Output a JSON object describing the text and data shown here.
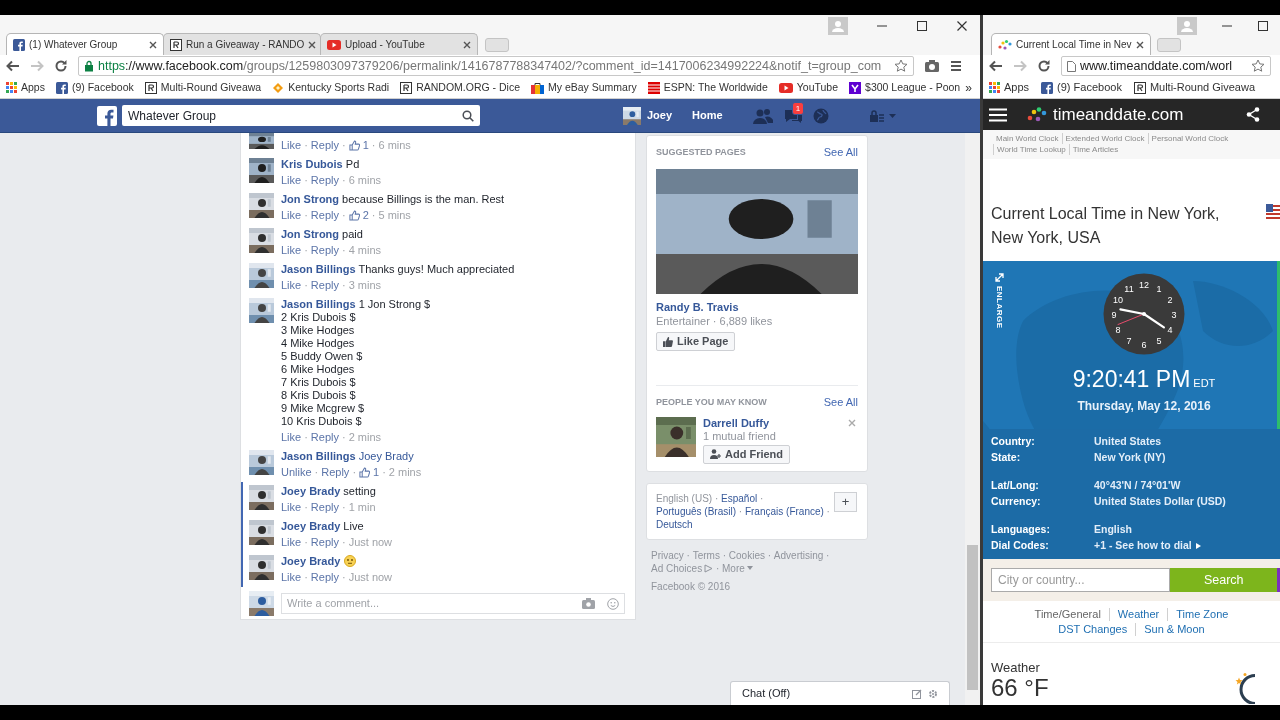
{
  "separator": "·",
  "left_window": {
    "tabs": [
      {
        "label": "(1) Whatever Group",
        "kind": "facebook",
        "selected": true
      },
      {
        "label": "Run a Giveaway - RANDO",
        "kind": "random",
        "selected": false
      },
      {
        "label": "Upload - YouTube",
        "kind": "youtube",
        "selected": false
      }
    ],
    "url": {
      "scheme": "https",
      "host": "://www.facebook.com",
      "path": "/groups/1259803097379206/permalink/1416787788347402/?comment_id=1417006234992224&notif_t=group_com"
    },
    "bookmarks": [
      {
        "label": "Apps",
        "kind": "apps"
      },
      {
        "label": "(9) Facebook",
        "kind": "facebook"
      },
      {
        "label": "Multi-Round Giveawa",
        "kind": "random"
      },
      {
        "label": "Kentucky Sports Radi",
        "kind": "kentucky"
      },
      {
        "label": "RANDOM.ORG - Dice",
        "kind": "random"
      },
      {
        "label": "My eBay Summary",
        "kind": "ebay"
      },
      {
        "label": "ESPN: The Worldwide",
        "kind": "espn"
      },
      {
        "label": "YouTube",
        "kind": "youtube"
      },
      {
        "label": "$300 League - Poon",
        "kind": "yahoo"
      }
    ],
    "more_bookmarks": "»"
  },
  "facebook": {
    "search_value": "Whatever Group",
    "user": "Joey",
    "home": "Home",
    "notification_count": "1",
    "comments": [
      {
        "kind": "partial",
        "like": "Like",
        "reply": "Reply",
        "likes": "1",
        "time": "6 mins",
        "highlighted": false
      },
      {
        "kind": "text",
        "author": "Kris Dubois",
        "lines": [
          "Pd"
        ],
        "like": "Like",
        "reply": "Reply",
        "time": "6 mins",
        "highlighted": false
      },
      {
        "kind": "text",
        "author": "Jon Strong",
        "lines": [
          "because Billings is the man. Rest"
        ],
        "like": "Like",
        "reply": "Reply",
        "likes": "2",
        "time": "5 mins",
        "highlighted": false
      },
      {
        "kind": "text",
        "author": "Jon Strong",
        "lines": [
          "paid"
        ],
        "like": "Like",
        "reply": "Reply",
        "time": "4 mins",
        "highlighted": false
      },
      {
        "kind": "text",
        "author": "Jason Billings",
        "lines": [
          "Thanks guys! Much appreciated"
        ],
        "like": "Like",
        "reply": "Reply",
        "time": "3 mins",
        "highlighted": false
      },
      {
        "kind": "text",
        "author": "Jason Billings",
        "lines": [
          "1 Jon Strong $",
          "2 Kris Dubois $",
          "3 Mike Hodges",
          "4 Mike Hodges",
          "5 Buddy Owen $",
          "6 Mike Hodges",
          "7 Kris Dubois $",
          "8 Kris Dubois $",
          "9 Mike Mcgrew $",
          "10 Kris Dubois $"
        ],
        "like": "Like",
        "reply": "Reply",
        "time": "2 mins",
        "highlighted": false
      },
      {
        "kind": "tag",
        "author": "Jason Billings",
        "tag": "Joey Brady",
        "like": "Unlike",
        "reply": "Reply",
        "likes": "1",
        "time": "2 mins",
        "highlighted": false
      },
      {
        "kind": "text",
        "author": "Joey Brady",
        "lines": [
          "setting"
        ],
        "like": "Like",
        "reply": "Reply",
        "time": "1 min",
        "highlighted": true
      },
      {
        "kind": "text",
        "author": "Joey Brady",
        "lines": [
          "Live"
        ],
        "like": "Like",
        "reply": "Reply",
        "time": "Just now",
        "highlighted": true
      },
      {
        "kind": "emoji",
        "author": "Joey Brady",
        "like": "Like",
        "reply": "Reply",
        "time": "Just now",
        "highlighted": true
      }
    ],
    "comment_placeholder": "Write a comment...",
    "suggested_pages": {
      "heading": "SUGGESTED PAGES",
      "see_all": "See All",
      "name": "Randy B. Travis",
      "meta": "Entertainer · 6,889 likes",
      "button": "Like Page"
    },
    "people": {
      "heading": "PEOPLE YOU MAY KNOW",
      "see_all": "See All",
      "name": "Darrell Duffy",
      "mutual": "1 mutual friend",
      "button": "Add Friend"
    },
    "languages": [
      {
        "label": "English (US)",
        "current": true
      },
      {
        "label": "Español",
        "current": false
      },
      {
        "label": "Português (Brasil)",
        "current": false
      },
      {
        "label": "Français (France)",
        "current": false
      },
      {
        "label": "Deutsch",
        "current": false
      }
    ],
    "add_language": "+",
    "footer_links": [
      {
        "label": "Privacy",
        "kind": "plain"
      },
      {
        "label": "Terms",
        "kind": "plain"
      },
      {
        "label": "Cookies",
        "kind": "plain"
      },
      {
        "label": "Advertising",
        "kind": "plain"
      },
      {
        "label": "Ad Choices",
        "kind": "adchoices"
      },
      {
        "label": "More",
        "kind": "caret"
      }
    ],
    "copyright": "Facebook © 2016",
    "chat": "Chat (Off)"
  },
  "right_window": {
    "tab": "Current Local Time in Nev",
    "url": "www.timeanddate.com/worl",
    "bookmarks": [
      {
        "label": "Apps",
        "kind": "apps"
      },
      {
        "label": "(9) Facebook",
        "kind": "facebook"
      },
      {
        "label": "Multi-Round Giveawa",
        "kind": "random"
      }
    ],
    "logo": "timeanddate.com",
    "nav": [
      "Main World Clock",
      "Extended World Clock",
      "Personal World Clock",
      "World Time Lookup",
      "Time Articles"
    ],
    "title": "Current Local Time in New York, New York, USA",
    "enlarge": "ENLARGE",
    "clock_numbers": [
      "12",
      "11",
      "1",
      "10",
      "2",
      "9",
      "3",
      "8",
      "4",
      "7",
      "5",
      "6"
    ],
    "time": "9:20:41 PM",
    "zone": "EDT",
    "date": "Thursday, May 12, 2016",
    "facts": [
      [
        {
          "label": "Country:",
          "value": "United States"
        },
        {
          "label": "State:",
          "value": "New York (NY)"
        }
      ],
      [
        {
          "label": "Lat/Long:",
          "value": "40°43'N / 74°01'W"
        },
        {
          "label": "Currency:",
          "value": "United States Dollar (USD)"
        }
      ],
      [
        {
          "label": "Languages:",
          "value": "English"
        },
        {
          "label": "Dial Codes:",
          "value": "+1 - See how to dial",
          "arrow": true
        }
      ]
    ],
    "search_placeholder": "City or country...",
    "search_button": "Search",
    "links": [
      {
        "label": "Time/General",
        "selected": true
      },
      {
        "label": "Weather",
        "selected": false
      },
      {
        "label": "Time Zone",
        "selected": false
      },
      {
        "label": "DST Changes",
        "selected": false
      },
      {
        "label": "Sun & Moon",
        "selected": false
      }
    ],
    "weather_label": "Weather",
    "temperature": "66 °F"
  }
}
